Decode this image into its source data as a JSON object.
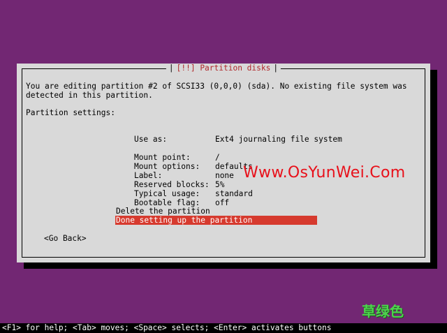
{
  "dialog": {
    "title": "[!!] Partition disks",
    "intro_line1": "You are editing partition #2 of SCSI33 (0,0,0) (sda). No existing file system was",
    "intro_line2": "detected in this partition.",
    "settings_heading": "Partition settings:",
    "settings": [
      {
        "label": "Use as:",
        "value": "Ext4 journaling file system"
      },
      {
        "label": "Mount point:",
        "value": "/"
      },
      {
        "label": "Mount options:",
        "value": "defaults"
      },
      {
        "label": "Label:",
        "value": "none"
      },
      {
        "label": "Reserved blocks:",
        "value": "5%"
      },
      {
        "label": "Typical usage:",
        "value": "standard"
      },
      {
        "label": "Bootable flag:",
        "value": "off"
      }
    ],
    "actions": [
      {
        "label": "Delete the partition",
        "selected": false
      },
      {
        "label": "Done setting up the partition",
        "selected": true
      }
    ],
    "go_back_label": "<Go Back>"
  },
  "watermark": "Www.OsYunWei.Com",
  "stamp": "草绿色",
  "help_bar": "<F1> for help; <Tab> moves; <Space> selects; <Enter> activates buttons",
  "colors": {
    "background": "#722773",
    "dialog": "#d9d9d9",
    "title": "#b0282b",
    "selection": "#d63a2e",
    "watermark": "#e8101a"
  }
}
